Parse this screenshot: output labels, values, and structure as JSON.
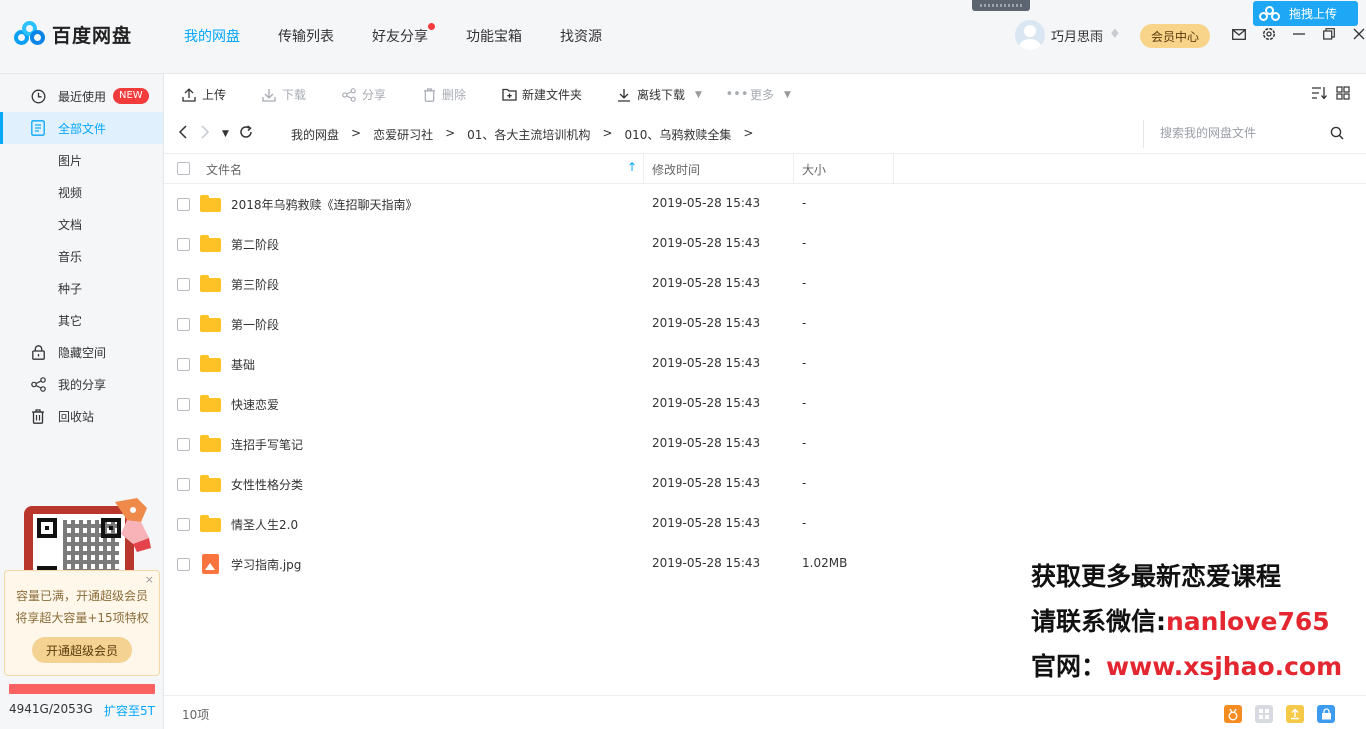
{
  "app": {
    "logo_text": "百度网盘"
  },
  "topnav": [
    {
      "label": "我的网盘",
      "active": true
    },
    {
      "label": "传输列表",
      "active": false
    },
    {
      "label": "好友分享",
      "active": false,
      "dot": true
    },
    {
      "label": "功能宝箱",
      "active": false
    },
    {
      "label": "找资源",
      "active": false
    }
  ],
  "header": {
    "username": "巧月思雨",
    "vip_button": "会员中心",
    "drag_upload": "拖拽上传",
    "icons": [
      "mail-icon",
      "settings-icon",
      "minimize-icon",
      "restore-icon",
      "close-icon"
    ]
  },
  "sidebar": {
    "items": [
      {
        "label": "最近使用",
        "icon": "clock-icon",
        "badge": "NEW"
      },
      {
        "label": "全部文件",
        "icon": "file-icon",
        "active": true
      },
      {
        "label": "图片"
      },
      {
        "label": "视频"
      },
      {
        "label": "文档"
      },
      {
        "label": "音乐"
      },
      {
        "label": "种子"
      },
      {
        "label": "其它"
      },
      {
        "label": "隐藏空间",
        "icon": "lock-icon"
      },
      {
        "label": "我的分享",
        "icon": "share-icon"
      },
      {
        "label": "回收站",
        "icon": "trash-icon"
      }
    ],
    "promo": {
      "line1": "容量已满，开通超级会员",
      "line2": "将享超大容量+15项特权",
      "button": "开通超级会员",
      "close": "×"
    },
    "quota": {
      "used": "4941G/2053G",
      "expand": "扩容至5T",
      "fill_ratio": 1.0
    }
  },
  "toolbar": {
    "upload": "上传",
    "download": "下载",
    "share": "分享",
    "delete": "删除",
    "new_folder": "新建文件夹",
    "offline_download": "离线下载",
    "more": "更多"
  },
  "breadcrumb": [
    "我的网盘",
    "恋爱研习社",
    "01、各大主流培训机构",
    "010、乌鸦救赎全集"
  ],
  "search": {
    "placeholder": "搜索我的网盘文件"
  },
  "table": {
    "headers": {
      "name": "文件名",
      "time": "修改时间",
      "size": "大小"
    },
    "rows": [
      {
        "name": "2018年乌鸦救赎《连招聊天指南》",
        "time": "2019-05-28 15:43",
        "size": "-",
        "type": "folder"
      },
      {
        "name": "第二阶段",
        "time": "2019-05-28 15:43",
        "size": "-",
        "type": "folder"
      },
      {
        "name": "第三阶段",
        "time": "2019-05-28 15:43",
        "size": "-",
        "type": "folder"
      },
      {
        "name": "第一阶段",
        "time": "2019-05-28 15:43",
        "size": "-",
        "type": "folder"
      },
      {
        "name": "基础",
        "time": "2019-05-28 15:43",
        "size": "-",
        "type": "folder"
      },
      {
        "name": "快速恋爱",
        "time": "2019-05-28 15:43",
        "size": "-",
        "type": "folder"
      },
      {
        "name": "连招手写笔记",
        "time": "2019-05-28 15:43",
        "size": "-",
        "type": "folder"
      },
      {
        "name": "女性性格分类",
        "time": "2019-05-28 15:43",
        "size": "-",
        "type": "folder"
      },
      {
        "name": "情圣人生2.0",
        "time": "2019-05-28 15:43",
        "size": "-",
        "type": "folder"
      },
      {
        "name": "学习指南.jpg",
        "time": "2019-05-28 15:43",
        "size": "1.02MB",
        "type": "image"
      }
    ]
  },
  "watermark": {
    "line1": "获取更多最新恋爱课程",
    "line2_prefix": "请联系微信:",
    "line2_value": "nanlove765",
    "line3_prefix": "官网：",
    "line3_value": "www.xsjhao.com"
  },
  "footer": {
    "count": "10项"
  },
  "colors": {
    "accent": "#06a7ff",
    "folder": "#ffc226",
    "quota_full": "#fa6262",
    "vip": "#f8d48a"
  }
}
